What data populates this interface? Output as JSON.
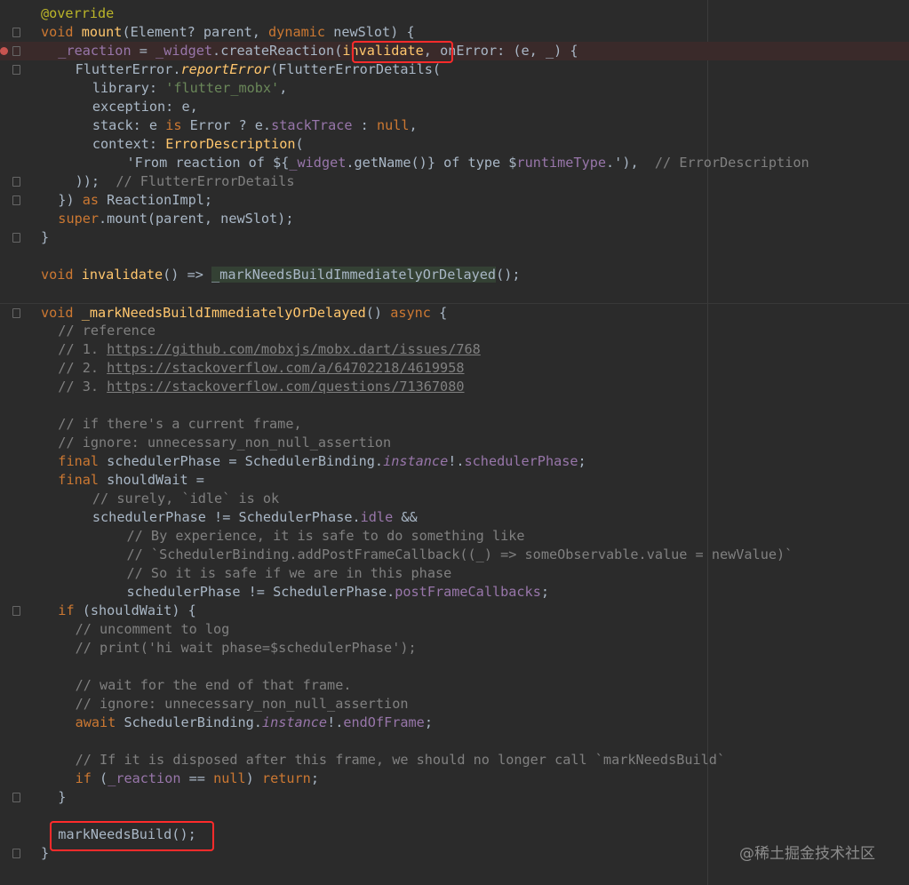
{
  "editor": {
    "lines": [
      {
        "indent": 0,
        "parts": [
          [
            "@override",
            "ann"
          ]
        ]
      },
      {
        "indent": 0,
        "parts": [
          [
            "void ",
            "kw"
          ],
          [
            "mount",
            "fn"
          ],
          [
            "(Element? parent, ",
            ""
          ],
          [
            "dynamic ",
            "kw"
          ],
          [
            "newSlot) {",
            ""
          ]
        ]
      },
      {
        "indent": 1,
        "parts": [
          [
            "_reaction",
            "fld"
          ],
          [
            " = ",
            ""
          ],
          [
            "_widget",
            "fld"
          ],
          [
            ".createReaction(",
            ""
          ],
          [
            "invalidate",
            "fn"
          ],
          [
            ", onError: (e, _) {",
            ""
          ]
        ]
      },
      {
        "indent": 2,
        "parts": [
          [
            "FlutterError.",
            ""
          ],
          [
            "reportError",
            "it-fn"
          ],
          [
            "(FlutterErrorDetails(",
            ""
          ]
        ]
      },
      {
        "indent": 3,
        "parts": [
          [
            "library: ",
            ""
          ],
          [
            "'flutter_mobx'",
            "str"
          ],
          [
            ",",
            ""
          ]
        ]
      },
      {
        "indent": 3,
        "parts": [
          [
            "exception: e,",
            ""
          ]
        ]
      },
      {
        "indent": 3,
        "parts": [
          [
            "stack: e ",
            ""
          ],
          [
            "is ",
            "kw"
          ],
          [
            "Error ? e.",
            ""
          ],
          [
            "stackTrace",
            "fld"
          ],
          [
            " : ",
            ""
          ],
          [
            "null",
            "kw"
          ],
          [
            ",",
            ""
          ]
        ]
      },
      {
        "indent": 3,
        "parts": [
          [
            "context: ",
            ""
          ],
          [
            "ErrorDescription",
            "fn"
          ],
          [
            "(",
            ""
          ]
        ]
      },
      {
        "indent": 5,
        "parts": [
          [
            "'From reaction of ${",
            ""
          ],
          [
            "_widget",
            "fld"
          ],
          [
            ".getName()} of type $",
            ""
          ],
          [
            "runtimeType",
            "fld"
          ],
          [
            ".'",
            ""
          ],
          [
            "),  ",
            ""
          ],
          [
            "// ErrorDescription",
            "cmt"
          ]
        ]
      },
      {
        "indent": 2,
        "parts": [
          [
            "));  ",
            ""
          ],
          [
            "// FlutterErrorDetails",
            "cmt"
          ]
        ]
      },
      {
        "indent": 1,
        "parts": [
          [
            "}) ",
            ""
          ],
          [
            "as ",
            "kw"
          ],
          [
            "ReactionImpl;",
            ""
          ]
        ]
      },
      {
        "indent": 1,
        "parts": [
          [
            "super",
            "kw"
          ],
          [
            ".mount(parent, newSlot);",
            ""
          ]
        ]
      },
      {
        "indent": 0,
        "parts": [
          [
            "}",
            ""
          ]
        ]
      },
      {
        "indent": 0,
        "parts": []
      },
      {
        "indent": 0,
        "parts": [
          [
            "void ",
            "kw"
          ],
          [
            "invalidate",
            "fn"
          ],
          [
            "() => ",
            ""
          ],
          [
            "_markNeedsBuildImmediatelyOrDelayed",
            "bg"
          ],
          [
            "();",
            ""
          ]
        ]
      },
      {
        "indent": 0,
        "parts": []
      },
      {
        "indent": 0,
        "parts": [
          [
            "void ",
            "kw"
          ],
          [
            "_markNeedsBuildImmediatelyOrDelayed",
            "fn"
          ],
          [
            "() ",
            ""
          ],
          [
            "async ",
            "kw"
          ],
          [
            "{",
            ""
          ]
        ]
      },
      {
        "indent": 1,
        "parts": [
          [
            "// reference",
            "cmt"
          ]
        ]
      },
      {
        "indent": 1,
        "parts": [
          [
            "// 1. ",
            "cmt"
          ],
          [
            "https://github.com/mobxjs/mobx.dart/issues/768",
            "link"
          ]
        ]
      },
      {
        "indent": 1,
        "parts": [
          [
            "// 2. ",
            "cmt"
          ],
          [
            "https://stackoverflow.com/a/64702218/4619958",
            "link"
          ]
        ]
      },
      {
        "indent": 1,
        "parts": [
          [
            "// 3. ",
            "cmt"
          ],
          [
            "https://stackoverflow.com/questions/71367080",
            "link"
          ]
        ]
      },
      {
        "indent": 0,
        "parts": []
      },
      {
        "indent": 1,
        "parts": [
          [
            "// if there's a current frame,",
            "cmt"
          ]
        ]
      },
      {
        "indent": 1,
        "parts": [
          [
            "// ignore: unnecessary_non_null_assertion",
            "cmt"
          ]
        ]
      },
      {
        "indent": 1,
        "parts": [
          [
            "final ",
            "kw"
          ],
          [
            "schedulerPhase = SchedulerBinding.",
            ""
          ],
          [
            "instance",
            "it"
          ],
          [
            "!.",
            ""
          ],
          [
            "schedulerPhase",
            "fld"
          ],
          [
            ";",
            ""
          ]
        ]
      },
      {
        "indent": 1,
        "parts": [
          [
            "final ",
            "kw"
          ],
          [
            "shouldWait =",
            ""
          ]
        ]
      },
      {
        "indent": 3,
        "parts": [
          [
            "// surely, `idle` is ok",
            "cmt"
          ]
        ]
      },
      {
        "indent": 3,
        "parts": [
          [
            "schedulerPhase != SchedulerPhase.",
            ""
          ],
          [
            "idle",
            "fld"
          ],
          [
            " &&",
            ""
          ]
        ]
      },
      {
        "indent": 5,
        "parts": [
          [
            "// By experience, it is safe to do something like",
            "cmt"
          ]
        ]
      },
      {
        "indent": 5,
        "parts": [
          [
            "// `SchedulerBinding.addPostFrameCallback((_) => someObservable.value = newValue)`",
            "cmt"
          ]
        ]
      },
      {
        "indent": 5,
        "parts": [
          [
            "// So it is safe if we are in this phase",
            "cmt"
          ]
        ]
      },
      {
        "indent": 5,
        "parts": [
          [
            "schedulerPhase != SchedulerPhase.",
            ""
          ],
          [
            "postFrameCallbacks",
            "fld"
          ],
          [
            ";",
            ""
          ]
        ]
      },
      {
        "indent": 1,
        "parts": [
          [
            "if ",
            "kw"
          ],
          [
            "(shouldWait) {",
            ""
          ]
        ]
      },
      {
        "indent": 2,
        "parts": [
          [
            "// uncomment to log",
            "cmt"
          ]
        ]
      },
      {
        "indent": 2,
        "parts": [
          [
            "// print('hi wait phase=$schedulerPhase');",
            "cmt"
          ]
        ]
      },
      {
        "indent": 0,
        "parts": []
      },
      {
        "indent": 2,
        "parts": [
          [
            "// wait for the end of that frame.",
            "cmt"
          ]
        ]
      },
      {
        "indent": 2,
        "parts": [
          [
            "// ignore: unnecessary_non_null_assertion",
            "cmt"
          ]
        ]
      },
      {
        "indent": 2,
        "parts": [
          [
            "await ",
            "kw"
          ],
          [
            "SchedulerBinding.",
            ""
          ],
          [
            "instance",
            "it"
          ],
          [
            "!.",
            ""
          ],
          [
            "endOfFrame",
            "fld"
          ],
          [
            ";",
            ""
          ]
        ]
      },
      {
        "indent": 0,
        "parts": []
      },
      {
        "indent": 2,
        "parts": [
          [
            "// If it is disposed after this frame, we should no longer call `markNeedsBuild`",
            "cmt"
          ]
        ]
      },
      {
        "indent": 2,
        "parts": [
          [
            "if ",
            "kw"
          ],
          [
            "(",
            ""
          ],
          [
            "_reaction",
            "fld"
          ],
          [
            " == ",
            ""
          ],
          [
            "null",
            "kw"
          ],
          [
            ") ",
            ""
          ],
          [
            "return",
            "kw"
          ],
          [
            ";",
            ""
          ]
        ]
      },
      {
        "indent": 1,
        "parts": [
          [
            "}",
            ""
          ]
        ]
      },
      {
        "indent": 0,
        "parts": []
      },
      {
        "indent": 1,
        "parts": [
          [
            "markNeedsBuild();",
            ""
          ]
        ]
      },
      {
        "indent": 0,
        "parts": [
          [
            "}",
            ""
          ]
        ]
      }
    ]
  },
  "watermark": "@稀土掘金技术社区"
}
